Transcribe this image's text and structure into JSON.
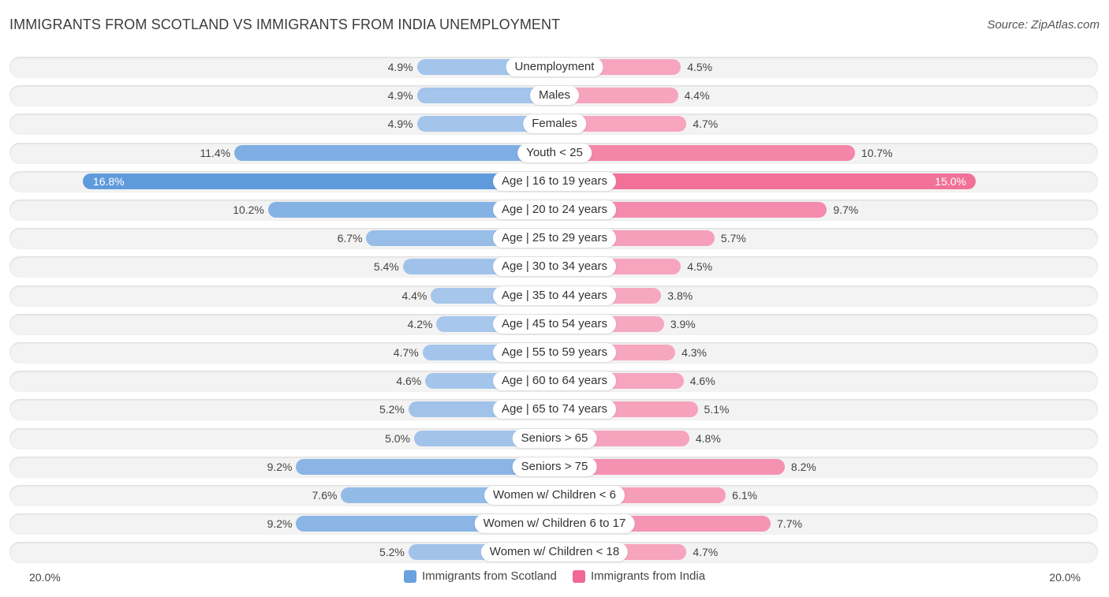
{
  "header": {
    "title": "IMMIGRANTS FROM SCOTLAND VS IMMIGRANTS FROM INDIA UNEMPLOYMENT",
    "source": "Source: ZipAtlas.com"
  },
  "colors": {
    "scotland_light": "#a9c8ec",
    "scotland_dark": "#5f9bdc",
    "india_light": "#f7a8c1",
    "india_dark": "#f06893"
  },
  "chart_data": {
    "type": "bar",
    "orientation": "diverging-horizontal",
    "title": "IMMIGRANTS FROM SCOTLAND VS IMMIGRANTS FROM INDIA UNEMPLOYMENT",
    "categories": [
      "Unemployment",
      "Males",
      "Females",
      "Youth < 25",
      "Age | 16 to 19 years",
      "Age | 20 to 24 years",
      "Age | 25 to 29 years",
      "Age | 30 to 34 years",
      "Age | 35 to 44 years",
      "Age | 45 to 54 years",
      "Age | 55 to 59 years",
      "Age | 60 to 64 years",
      "Age | 65 to 74 years",
      "Seniors > 65",
      "Seniors > 75",
      "Women w/ Children < 6",
      "Women w/ Children 6 to 17",
      "Women w/ Children < 18"
    ],
    "series": [
      {
        "name": "Immigrants from Scotland",
        "side": "left",
        "values": [
          4.9,
          4.9,
          4.9,
          11.4,
          16.8,
          10.2,
          6.7,
          5.4,
          4.4,
          4.2,
          4.7,
          4.6,
          5.2,
          5.0,
          9.2,
          7.6,
          9.2,
          5.2
        ],
        "labels": [
          "4.9%",
          "4.9%",
          "4.9%",
          "11.4%",
          "16.8%",
          "10.2%",
          "6.7%",
          "5.4%",
          "4.4%",
          "4.2%",
          "4.7%",
          "4.6%",
          "5.2%",
          "5.0%",
          "9.2%",
          "7.6%",
          "9.2%",
          "5.2%"
        ]
      },
      {
        "name": "Immigrants from India",
        "side": "right",
        "values": [
          4.5,
          4.4,
          4.7,
          10.7,
          15.0,
          9.7,
          5.7,
          4.5,
          3.8,
          3.9,
          4.3,
          4.6,
          5.1,
          4.8,
          8.2,
          6.1,
          7.7,
          4.7
        ],
        "labels": [
          "4.5%",
          "4.4%",
          "4.7%",
          "10.7%",
          "15.0%",
          "9.7%",
          "5.7%",
          "4.5%",
          "3.8%",
          "3.9%",
          "4.3%",
          "4.6%",
          "5.1%",
          "4.8%",
          "8.2%",
          "6.1%",
          "7.7%",
          "4.7%"
        ]
      }
    ],
    "xlim": [
      -20,
      20
    ],
    "axis_labels": {
      "left": "20.0%",
      "right": "20.0%"
    },
    "unit": "%",
    "legend": {
      "position": "bottom-center",
      "items": [
        "Immigrants from Scotland",
        "Immigrants from India"
      ]
    }
  }
}
